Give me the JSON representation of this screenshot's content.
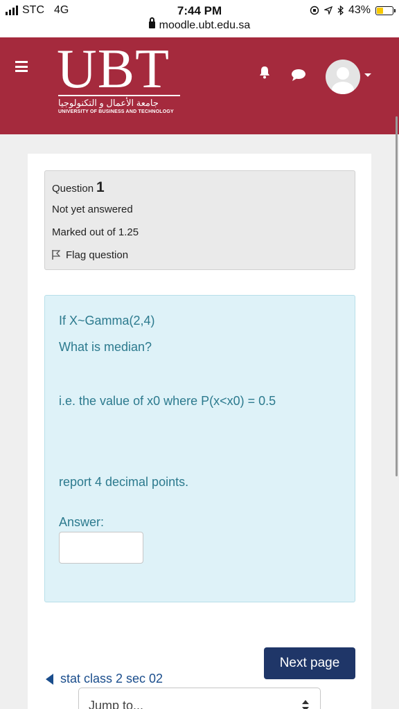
{
  "status_bar": {
    "carrier": "STC",
    "network": "4G",
    "time": "7:44 PM",
    "url": "moodle.ubt.edu.sa",
    "battery": "43%",
    "battery_level": 0.43
  },
  "header": {
    "logo_text": "UBT",
    "logo_arabic": "جامعة الأعمال و التكنولوجيا",
    "logo_sub": "UNIVERSITY OF BUSINESS AND TECHNOLOGY",
    "icons": [
      "menu-icon",
      "bell-icon",
      "chat-icon",
      "avatar",
      "caret-down-icon"
    ],
    "brand_color": "#a52a3d"
  },
  "question_info": {
    "label": "Question",
    "number": "1",
    "status": "Not yet answered",
    "marks": "Marked out of 1.25",
    "flag_label": "Flag question"
  },
  "question": {
    "line1": "If X~Gamma(2,4)",
    "line2": "What is median?",
    "line3": "i.e. the value of x0 where P(x<x0) = 0.5",
    "line4": "report 4 decimal points.",
    "answer_label": "Answer:",
    "answer_value": ""
  },
  "navigation": {
    "next_label": "Next page",
    "prev_label": "stat class 2 sec 02",
    "jump_label": "Jump to..."
  }
}
